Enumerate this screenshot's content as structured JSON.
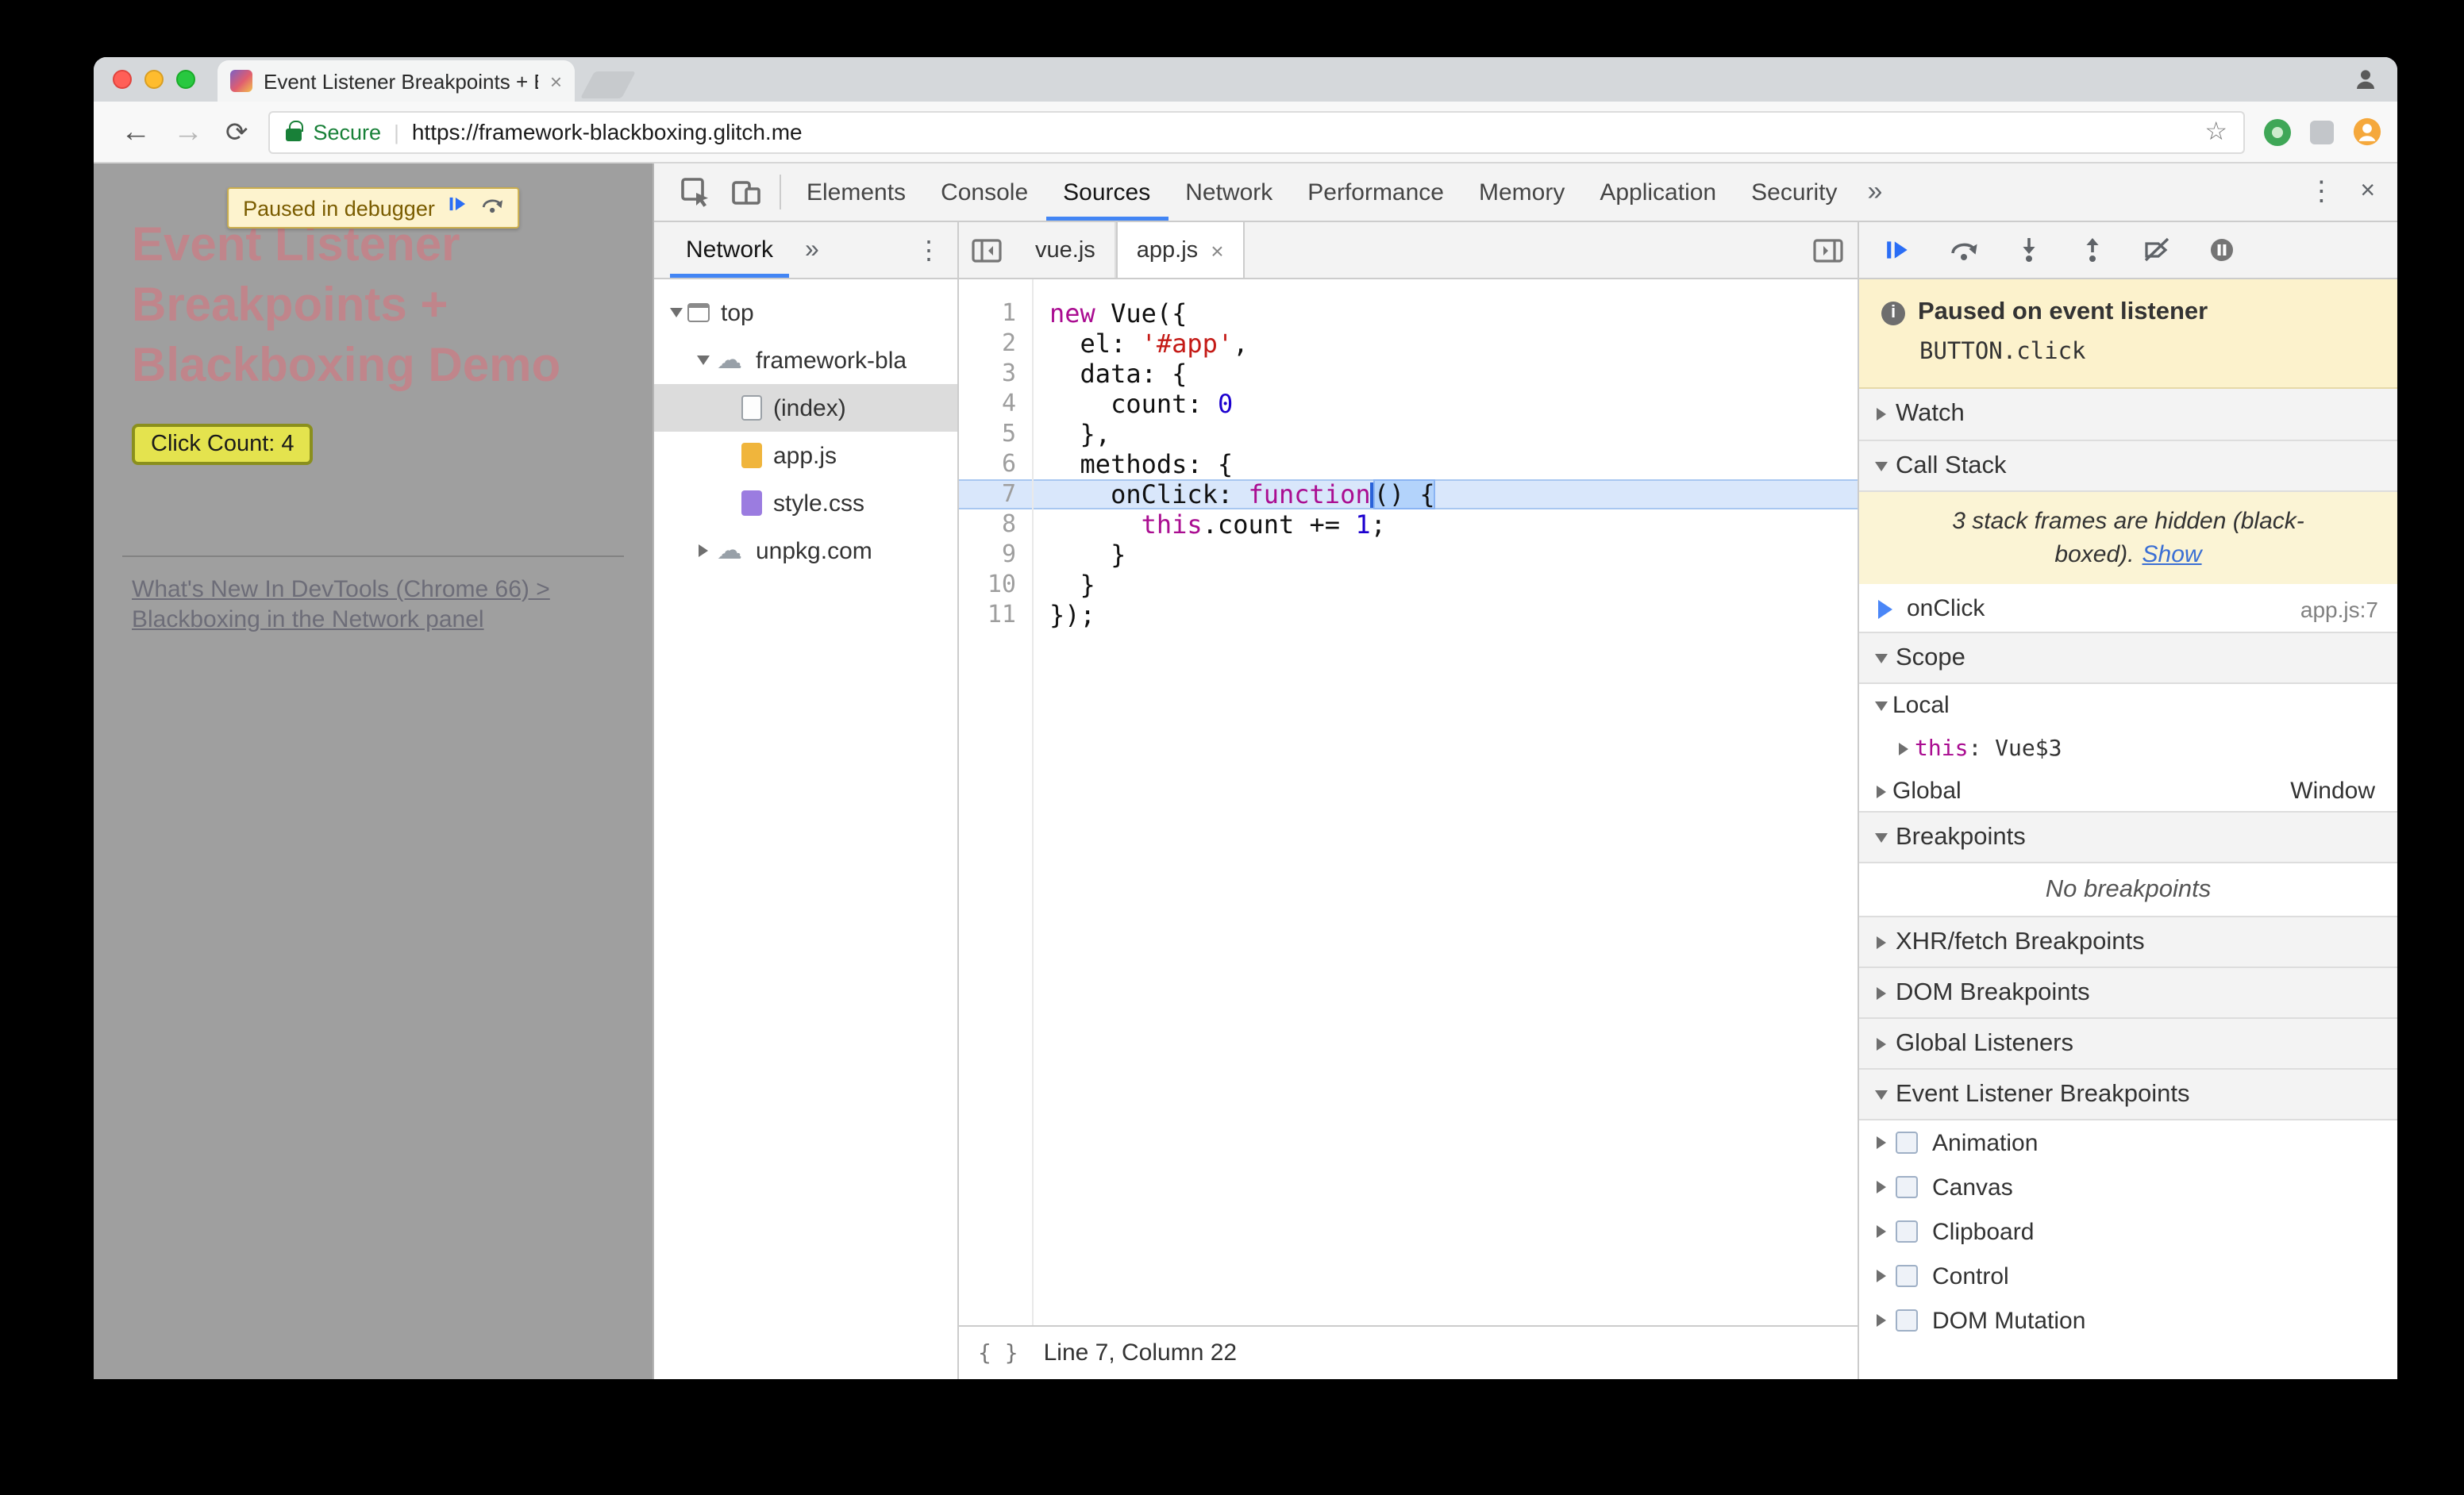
{
  "colors": {
    "accent_blue": "#4285f4",
    "secure_green": "#188038",
    "paused_banner_bg": "#fcf2cc",
    "execution_line_bg": "#d9e7fb",
    "syntax_keyword": "#aa0d91",
    "syntax_string": "#c41a16",
    "syntax_number": "#1c00cf",
    "heading_pink": "#c0858b",
    "button_yellow": "#e4e34e"
  },
  "glyphs": {
    "back": "←",
    "forward": "→",
    "reload": "⟳",
    "star": "☆",
    "kebab": "⋮",
    "close": "×",
    "tab_close": "×",
    "overflow_chevron": "»",
    "url_separator": "|",
    "pretty_print": "{ }"
  },
  "browser": {
    "tab_title": "Event Listener Breakpoints + B",
    "secure_label": "Secure",
    "url": "https://framework-blackboxing.glitch.me"
  },
  "page": {
    "paused_banner": "Paused in debugger",
    "heading_lines": [
      "Event Listener",
      "Breakpoints +",
      "Blackboxing Demo"
    ],
    "click_button_label": "Click Count: 4",
    "link_line1": "What's New In DevTools (Chrome 66) >",
    "link_line2": "Blackboxing in the Network panel"
  },
  "devtools": {
    "main_tabs": [
      {
        "label": "Elements"
      },
      {
        "label": "Console"
      },
      {
        "label": "Sources",
        "selected": true
      },
      {
        "label": "Network"
      },
      {
        "label": "Performance"
      },
      {
        "label": "Memory"
      },
      {
        "label": "Application"
      },
      {
        "label": "Security"
      }
    ],
    "navigator": {
      "tab_label": "Network",
      "tree": [
        {
          "depth": 0,
          "arrow": "down",
          "icon": "frame",
          "label": "top"
        },
        {
          "depth": 1,
          "arrow": "down",
          "icon": "cloud",
          "label": "framework-bla"
        },
        {
          "depth": 2,
          "arrow": "none",
          "icon": "file-plain",
          "label": "(index)",
          "selected": true
        },
        {
          "depth": 2,
          "arrow": "none",
          "icon": "file-script",
          "label": "app.js"
        },
        {
          "depth": 2,
          "arrow": "none",
          "icon": "file-style",
          "label": "style.css"
        },
        {
          "depth": 1,
          "arrow": "right",
          "icon": "cloud",
          "label": "unpkg.com"
        }
      ]
    },
    "editor": {
      "tabs": [
        {
          "label": "vue.js",
          "active": false,
          "closable": false
        },
        {
          "label": "app.js",
          "active": true,
          "closable": true
        }
      ],
      "status_text": "Line 7, Column 22",
      "code_lines": [
        {
          "n": 1,
          "tokens": [
            {
              "t": "new",
              "c": "kw"
            },
            {
              "t": " Vue({",
              "c": "pl"
            }
          ]
        },
        {
          "n": 2,
          "tokens": [
            {
              "t": "  el: ",
              "c": "pl"
            },
            {
              "t": "'#app'",
              "c": "str"
            },
            {
              "t": ",",
              "c": "pl"
            }
          ]
        },
        {
          "n": 3,
          "tokens": [
            {
              "t": "  data: {",
              "c": "pl"
            }
          ]
        },
        {
          "n": 4,
          "tokens": [
            {
              "t": "    count: ",
              "c": "pl"
            },
            {
              "t": "0",
              "c": "num"
            }
          ]
        },
        {
          "n": 5,
          "tokens": [
            {
              "t": "  },",
              "c": "pl"
            }
          ]
        },
        {
          "n": 6,
          "tokens": [
            {
              "t": "  methods: {",
              "c": "pl"
            }
          ]
        },
        {
          "n": 7,
          "exec": true,
          "tokens": [
            {
              "t": "    onClick: ",
              "c": "pl"
            },
            {
              "t": "function",
              "c": "kw"
            },
            {
              "t": "",
              "c": "caret"
            },
            {
              "t": "() {",
              "c": "sel"
            }
          ]
        },
        {
          "n": 8,
          "tokens": [
            {
              "t": "      ",
              "c": "pl"
            },
            {
              "t": "this",
              "c": "kw"
            },
            {
              "t": ".count ",
              "c": "pl"
            },
            {
              "t": "+= ",
              "c": "pl"
            },
            {
              "t": "1",
              "c": "num"
            },
            {
              "t": ";",
              "c": "pl"
            }
          ]
        },
        {
          "n": 9,
          "tokens": [
            {
              "t": "    }",
              "c": "pl"
            }
          ]
        },
        {
          "n": 10,
          "tokens": [
            {
              "t": "  }",
              "c": "pl"
            }
          ]
        },
        {
          "n": 11,
          "tokens": [
            {
              "t": "});",
              "c": "pl"
            }
          ]
        }
      ]
    },
    "debugger": {
      "paused_title": "Paused on event listener",
      "paused_detail": "BUTTON.click",
      "watch_label": "Watch",
      "call_stack_label": "Call Stack",
      "blackbox_note_line1": "3 stack frames are hidden (black-",
      "blackbox_note_line2": "boxed).",
      "blackbox_show_label": "Show",
      "frame_name": "onClick",
      "frame_location": "app.js:7",
      "scope_label": "Scope",
      "scope_local_label": "Local",
      "scope_this_name": "this",
      "scope_this_sep": ": ",
      "scope_this_value": "Vue$3",
      "scope_global_label": "Global",
      "scope_global_value": "Window",
      "breakpoints_label": "Breakpoints",
      "no_breakpoints_text": "No breakpoints",
      "xhr_label": "XHR/fetch Breakpoints",
      "dom_label": "DOM Breakpoints",
      "global_listeners_label": "Global Listeners",
      "event_listener_label": "Event Listener Breakpoints",
      "event_categories": [
        "Animation",
        "Canvas",
        "Clipboard",
        "Control",
        "DOM Mutation"
      ]
    }
  }
}
